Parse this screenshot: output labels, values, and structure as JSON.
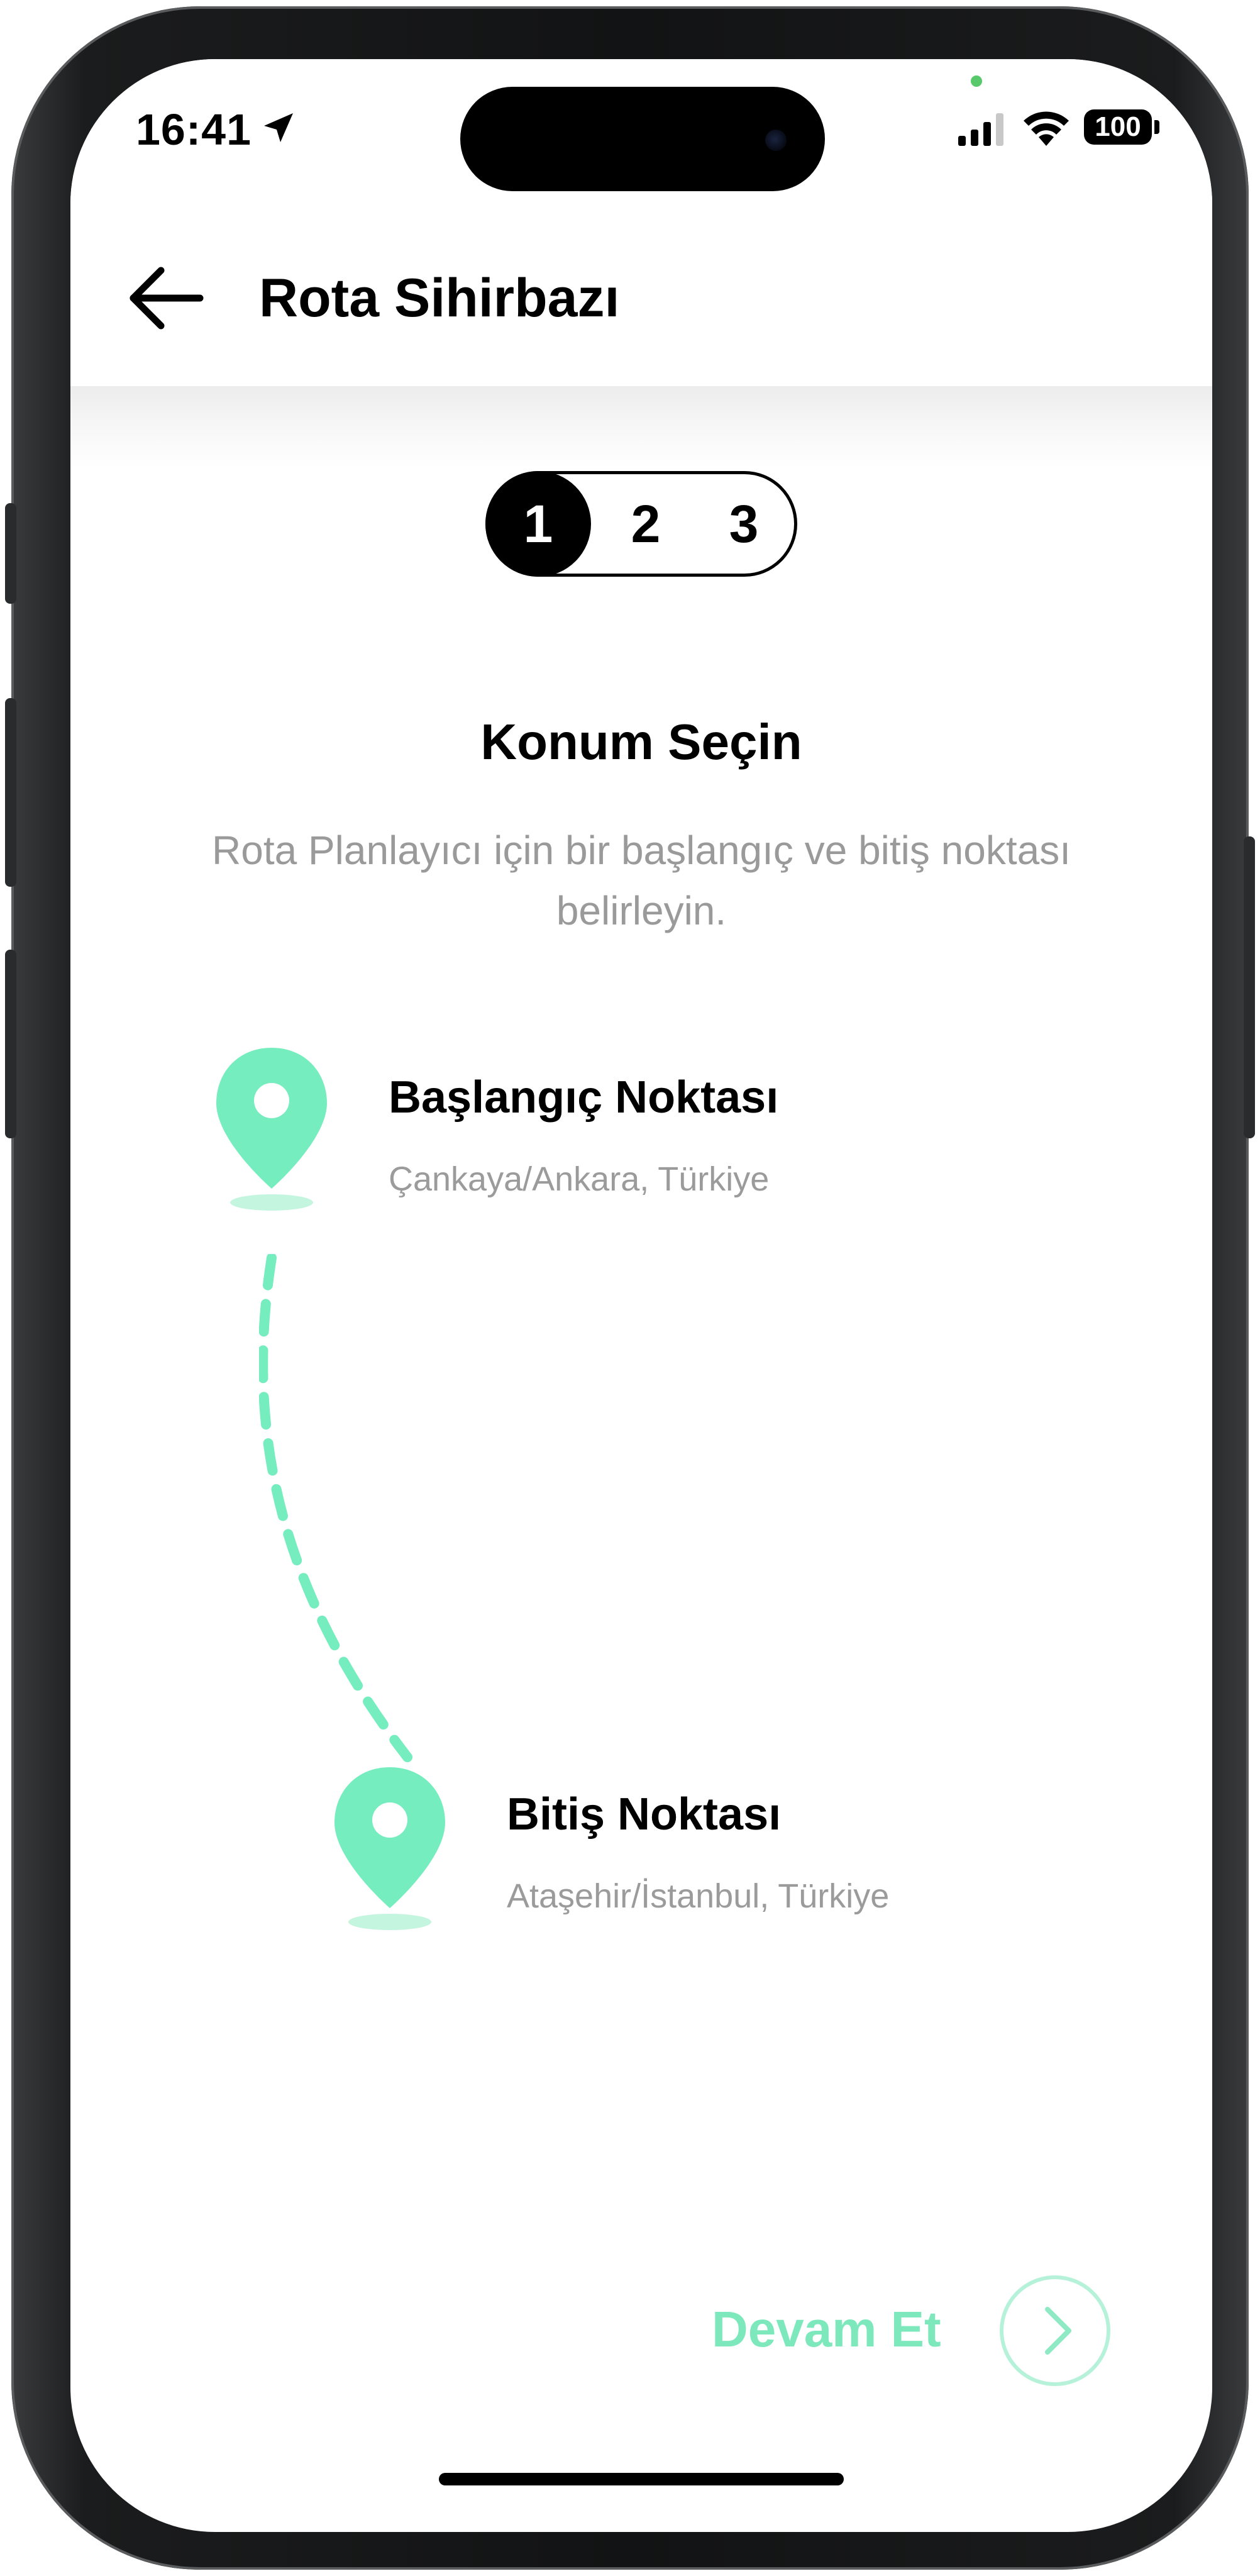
{
  "status_bar": {
    "time": "16:41",
    "battery": "100"
  },
  "header": {
    "title": "Rota Sihirbazı"
  },
  "stepper": {
    "steps": [
      "1",
      "2",
      "3"
    ],
    "active_step": 1
  },
  "section": {
    "title": "Konum Seçin",
    "description": "Rota Planlayıcı için bir başlangıç ve bitiş noktası belirleyin."
  },
  "start": {
    "name": "Başlangıç Noktası",
    "address": "Çankaya/Ankara, Türkiye"
  },
  "end": {
    "name": "Bitiş Noktası",
    "address": "Ataşehir/İstanbul, Türkiye"
  },
  "action": {
    "continue_label": "Devam Et"
  },
  "colors": {
    "accent": "#76edbf",
    "accent_light": "#b6f2d9",
    "muted_text": "#9b9b9b"
  },
  "icons": {
    "back": "arrow-left-icon",
    "pin": "map-pin-icon",
    "continue": "chevron-right-icon",
    "location": "location-arrow-icon",
    "signal": "cellular-signal-icon",
    "wifi": "wifi-icon"
  }
}
